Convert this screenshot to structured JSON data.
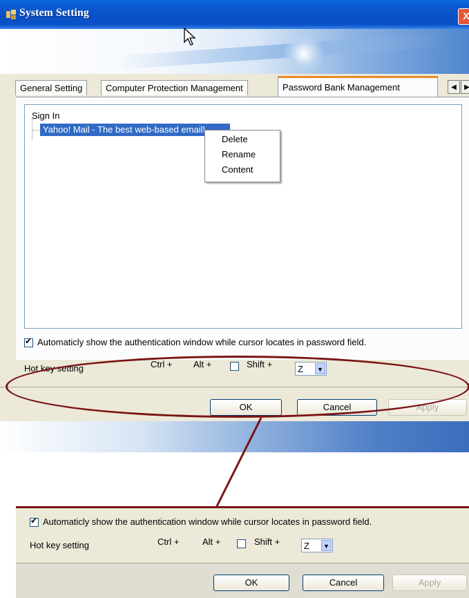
{
  "window": {
    "title": "System Setting",
    "close_glyph": "X"
  },
  "tabs": [
    {
      "label": "General Setting"
    },
    {
      "label": "Computer Protection Management"
    },
    {
      "label": "Password Bank Management"
    }
  ],
  "tab_scroll": {
    "left_glyph": "◀",
    "right_glyph": "▶"
  },
  "tree": {
    "root_label": "Sign In",
    "selected_item": "Yahoo! Mail - The best web-based email!"
  },
  "context_menu": {
    "items": [
      "Delete",
      "Rename",
      "Content"
    ]
  },
  "auth_option": {
    "label": "Automaticly show the authentication window while cursor locates in password field.",
    "checked": true
  },
  "hotkey": {
    "label": "Hot key setting",
    "ctrl": "Ctrl +",
    "alt": "Alt +",
    "shift": "Shift +",
    "shift_checked": false,
    "key_value": "Z"
  },
  "buttons": {
    "ok": "OK",
    "cancel": "Cancel",
    "apply": "Apply"
  },
  "colors": {
    "highlight": "#7a1414",
    "selection": "#316ac5",
    "titlebar": "#0a52c9"
  }
}
